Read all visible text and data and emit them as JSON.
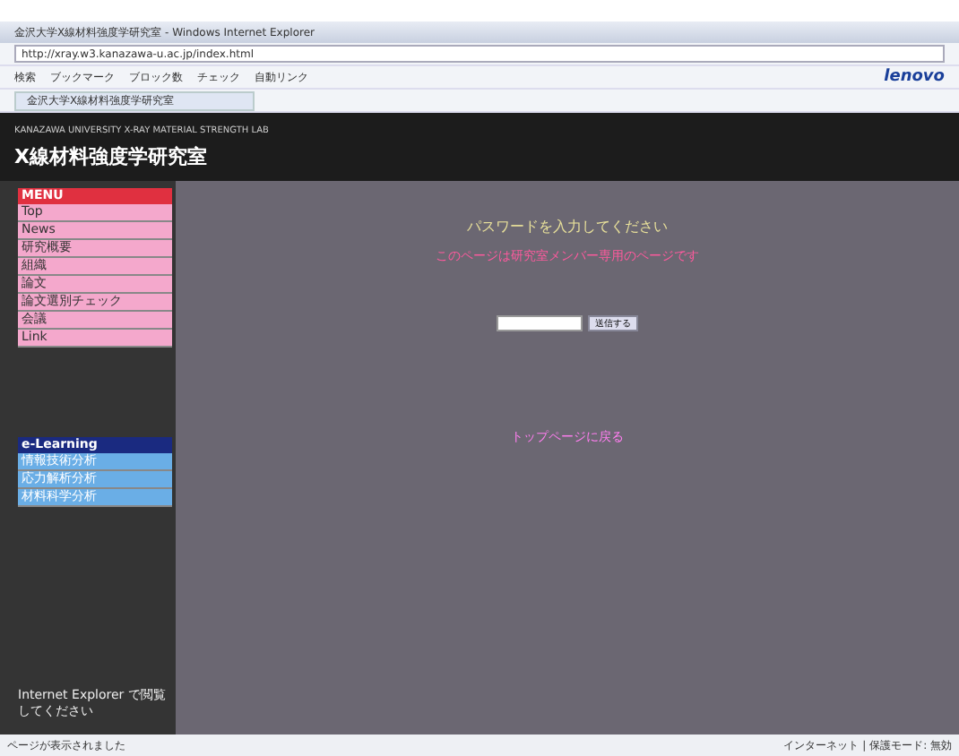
{
  "window": {
    "title": "金沢大学X線材料強度学研究室 - Windows Internet Explorer"
  },
  "address": {
    "url": "http://xray.w3.kanazawa-u.ac.jp/index.html"
  },
  "toolbar": {
    "items": [
      "検索",
      "ブックマーク",
      "ブロック数",
      "チェック",
      "自動リンク"
    ],
    "brand": "lenovo"
  },
  "tab": {
    "title": "金沢大学X線材料強度学研究室"
  },
  "site": {
    "subtitle": "KANAZAWA UNIVERSITY X-RAY MATERIAL STRENGTH LAB",
    "title": "X線材料強度学研究室"
  },
  "menu": {
    "heading": "MENU",
    "items": [
      "Top",
      "News",
      "研究概要",
      "組織",
      "論文",
      "論文選別チェック",
      "会議",
      "Link"
    ]
  },
  "elearning": {
    "heading": "e-Learning",
    "items": [
      "情報技術分析",
      "応力解析分析",
      "材料科学分析"
    ]
  },
  "sidebar_note": "Internet Explorer で閲覧してください",
  "login": {
    "prompt": "パスワードを入力してください",
    "notice": "このページは研究室メンバー専用のページです",
    "button": "送信する",
    "link": "トップページに戻る"
  },
  "status_bar": {
    "text": "ページが表示されました",
    "zone": "インターネット | 保護モード: 無効"
  }
}
